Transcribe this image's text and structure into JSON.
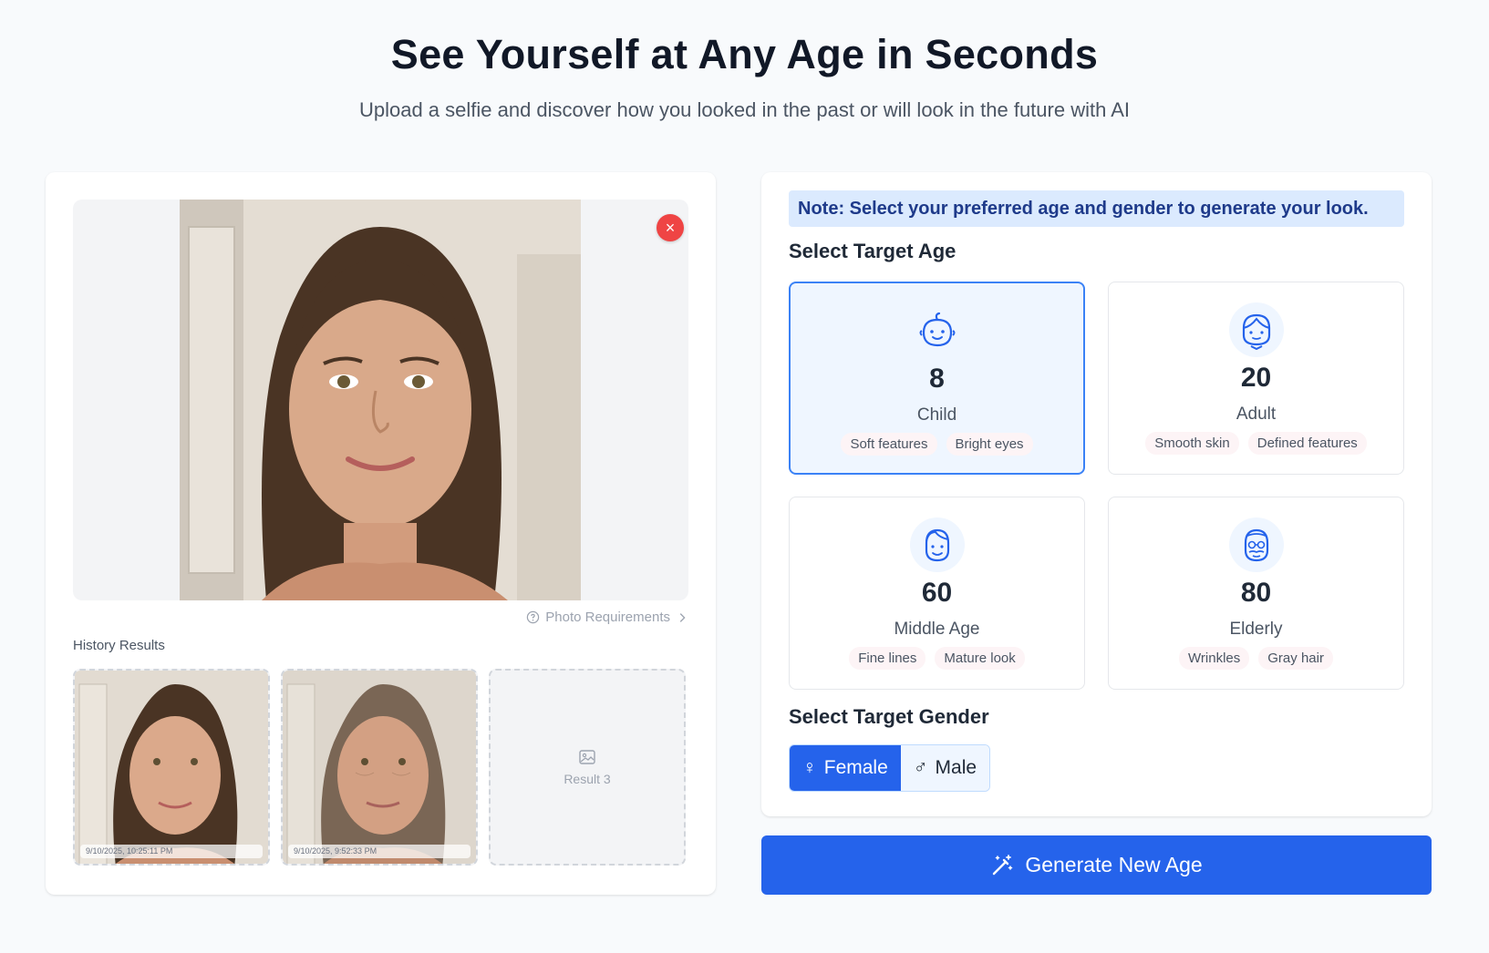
{
  "hero": {
    "title": "See Yourself at Any Age in Seconds",
    "subtitle": "Upload a selfie and discover how you looked in the past or will look in the future with AI"
  },
  "upload": {
    "remove_symbol": "×",
    "photo_requirements": "Photo Requirements",
    "history_label": "History Results",
    "history": [
      {
        "timestamp": "9/10/2025, 10:25:11 PM"
      },
      {
        "timestamp": "9/10/2025, 9:52:33 PM"
      },
      {
        "label": "Result 3"
      }
    ]
  },
  "settings": {
    "note": "Note: Select your preferred age and gender to generate your look.",
    "age_title": "Select Target Age",
    "ages": [
      {
        "value": "8",
        "name": "Child",
        "icon": "baby-icon",
        "tags": [
          "Soft features",
          "Bright eyes"
        ],
        "selected": true
      },
      {
        "value": "20",
        "name": "Adult",
        "icon": "adult-icon",
        "tags": [
          "Smooth skin",
          "Defined features"
        ],
        "selected": false
      },
      {
        "value": "60",
        "name": "Middle Age",
        "icon": "middle-age-icon",
        "tags": [
          "Fine lines",
          "Mature look"
        ],
        "selected": false
      },
      {
        "value": "80",
        "name": "Elderly",
        "icon": "elderly-icon",
        "tags": [
          "Wrinkles",
          "Gray hair"
        ],
        "selected": false
      }
    ],
    "gender_title": "Select Target Gender",
    "genders": [
      {
        "label": "Female",
        "symbol": "♀",
        "active": true
      },
      {
        "label": "Male",
        "symbol": "♂",
        "active": false
      }
    ]
  },
  "generate_label": "Generate New Age",
  "colors": {
    "accent": "#2563eb",
    "selected_bg": "#eff6ff",
    "remove": "#ef4444"
  }
}
